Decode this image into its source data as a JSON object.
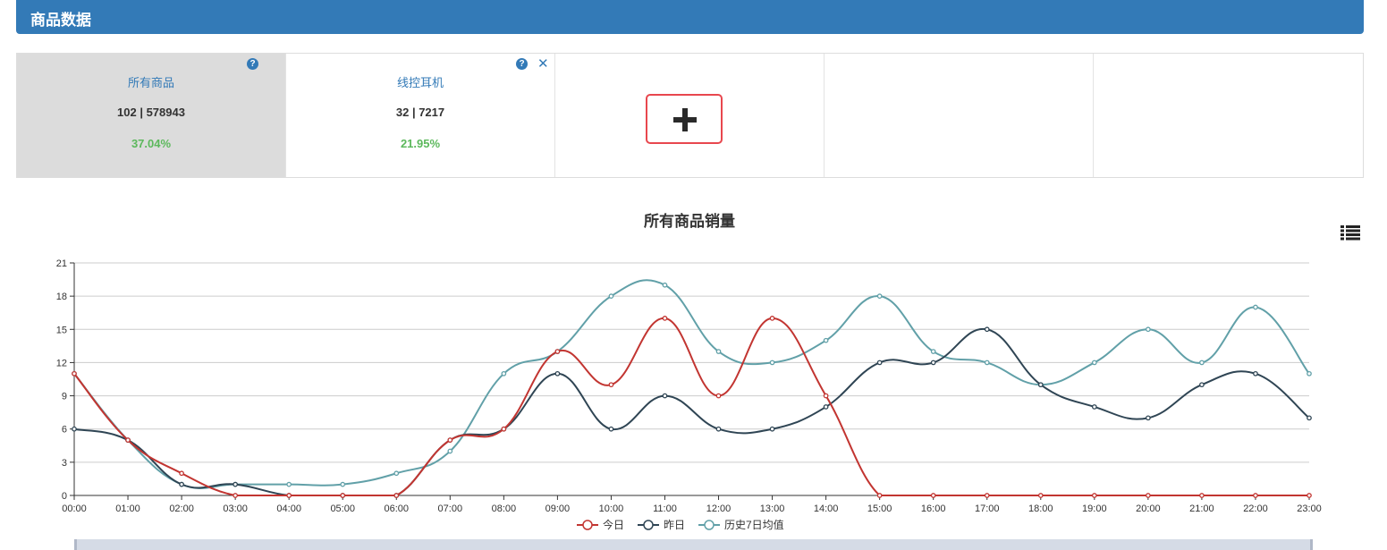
{
  "header": {
    "title": "商品数据"
  },
  "cards": [
    {
      "name": "所有商品",
      "count": "102 | 578943",
      "percent": "37.04%",
      "has_close": false
    },
    {
      "name": "线控耳机",
      "count": "32 | 7217",
      "percent": "21.95%",
      "has_close": true
    }
  ],
  "icons": {
    "help": "question-circle-icon",
    "close": "close-icon",
    "add": "plus-icon",
    "menu": "list-icon"
  },
  "help_glyph": "?",
  "close_glyph": "✕",
  "chart_data": {
    "type": "line",
    "title": "所有商品销量",
    "xlabel": "",
    "ylabel": "",
    "x": [
      "00:00",
      "01:00",
      "02:00",
      "03:00",
      "04:00",
      "05:00",
      "06:00",
      "07:00",
      "08:00",
      "09:00",
      "10:00",
      "11:00",
      "12:00",
      "13:00",
      "14:00",
      "15:00",
      "16:00",
      "17:00",
      "18:00",
      "19:00",
      "20:00",
      "21:00",
      "22:00",
      "23:00"
    ],
    "yticks": [
      0,
      3,
      6,
      9,
      12,
      15,
      18,
      21
    ],
    "ylim": [
      0,
      21
    ],
    "grid": true,
    "legend_position": "bottom",
    "series": [
      {
        "name": "今日",
        "color": "#c23531",
        "values": [
          11,
          5,
          2,
          0,
          0,
          0,
          0,
          5,
          6,
          13,
          10,
          16,
          9,
          16,
          9,
          0,
          0,
          0,
          0,
          0,
          0,
          0,
          0,
          0
        ]
      },
      {
        "name": "昨日",
        "color": "#2f4554",
        "values": [
          6,
          5,
          1,
          1,
          0,
          0,
          0,
          5,
          6,
          11,
          6,
          9,
          6,
          6,
          8,
          12,
          12,
          15,
          10,
          8,
          7,
          10,
          11,
          7
        ]
      },
      {
        "name": "历史7日均值",
        "color": "#61a0a8",
        "values": [
          11,
          5,
          1,
          1,
          1,
          1,
          2,
          4,
          11,
          13,
          18,
          19,
          13,
          12,
          14,
          18,
          13,
          12,
          10,
          12,
          15,
          12,
          17,
          11
        ]
      }
    ]
  }
}
